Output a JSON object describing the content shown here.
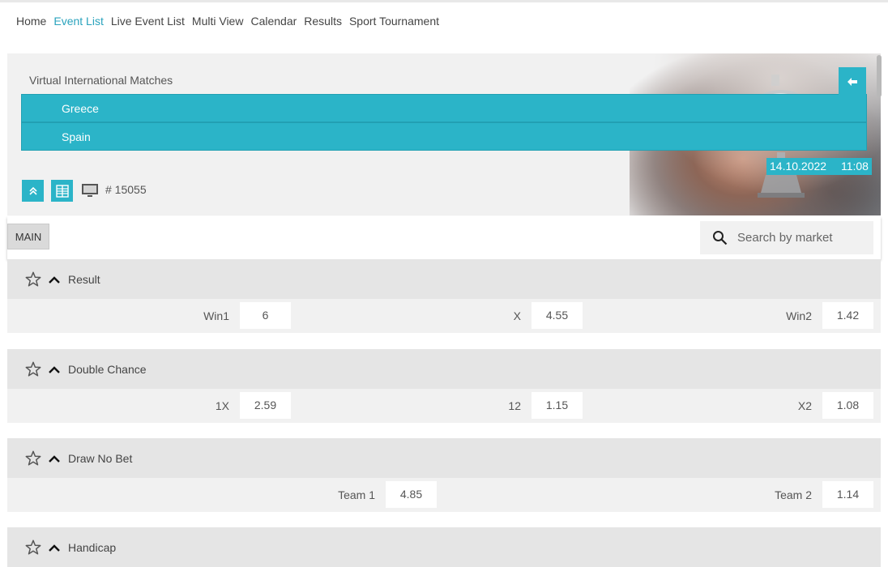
{
  "nav": {
    "items": [
      "Home",
      "Event List",
      "Live Event List",
      "Multi View",
      "Calendar",
      "Results",
      "Sport Tournament"
    ],
    "active": "Event List"
  },
  "event": {
    "competition": "Virtual International Matches",
    "team1": "Greece",
    "team2": "Spain",
    "date": "14.10.2022",
    "time": "11:08",
    "id": "# 15055"
  },
  "toolbar": {
    "main_tab": "MAIN",
    "search_placeholder": "Search by market"
  },
  "markets": [
    {
      "title": "Result",
      "outcomes": [
        {
          "label": "Win1",
          "odd": "6"
        },
        {
          "label": "X",
          "odd": "4.55"
        },
        {
          "label": "Win2",
          "odd": "1.42"
        }
      ]
    },
    {
      "title": "Double Chance",
      "outcomes": [
        {
          "label": "1X",
          "odd": "2.59"
        },
        {
          "label": "12",
          "odd": "1.15"
        },
        {
          "label": "X2",
          "odd": "1.08"
        }
      ]
    },
    {
      "title": "Draw No Bet",
      "outcomes": [
        {
          "label": "Team 1",
          "odd": "4.85"
        },
        {
          "label": "Team 2",
          "odd": "1.14"
        }
      ]
    },
    {
      "title": "Handicap",
      "outcomes": []
    }
  ],
  "colors": {
    "accent": "#2bb4c8",
    "active_link": "#2aa3bd",
    "market_header": "#e5e5e5",
    "market_body": "#f1f1f1"
  },
  "icons": [
    "back-arrow-icon",
    "double-chevron-up-icon",
    "grid-view-icon",
    "tv-icon",
    "search-icon",
    "star-icon",
    "chevron-up-icon"
  ]
}
